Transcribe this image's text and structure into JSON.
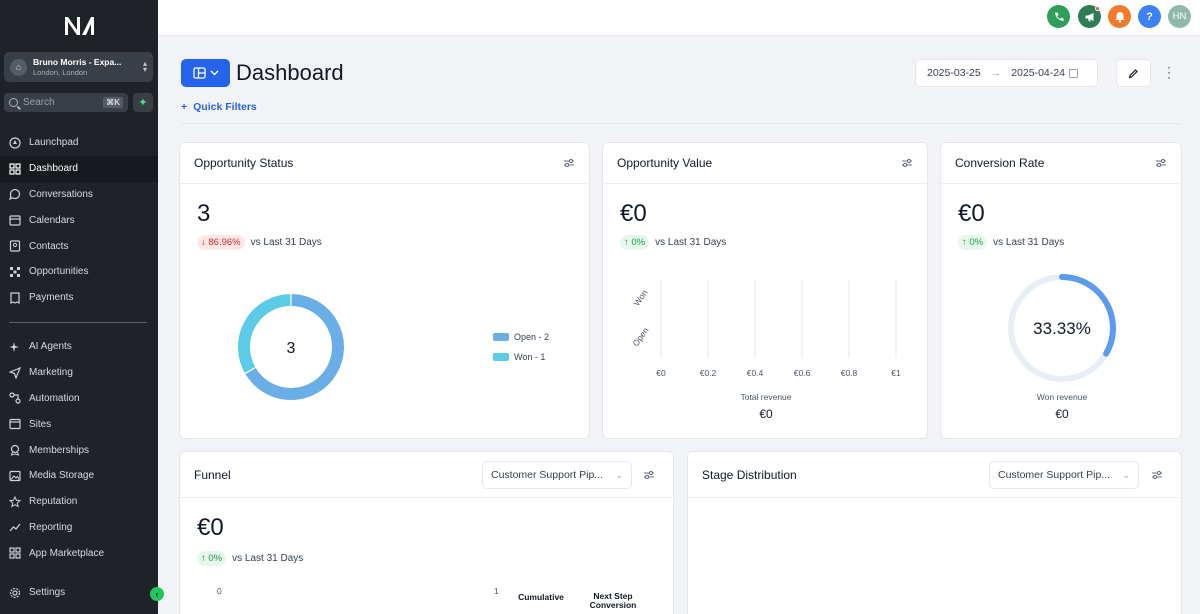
{
  "sidebar": {
    "account_name": "Bruno Morris - Expa...",
    "account_location": "London, London",
    "search_placeholder": "Search",
    "search_shortcut": "⌘K",
    "items": [
      {
        "label": "Launchpad"
      },
      {
        "label": "Dashboard"
      },
      {
        "label": "Conversations"
      },
      {
        "label": "Calendars"
      },
      {
        "label": "Contacts"
      },
      {
        "label": "Opportunities"
      },
      {
        "label": "Payments"
      },
      {
        "label": "AI Agents"
      },
      {
        "label": "Marketing"
      },
      {
        "label": "Automation"
      },
      {
        "label": "Sites"
      },
      {
        "label": "Memberships"
      },
      {
        "label": "Media Storage"
      },
      {
        "label": "Reputation"
      },
      {
        "label": "Reporting"
      },
      {
        "label": "App Marketplace"
      },
      {
        "label": "Settings"
      }
    ]
  },
  "topbar": {
    "avatar_initials": "HN",
    "help_label": "?",
    "colors": {
      "phone": "#2f9e58",
      "megaphone": "#2f7d52",
      "bell": "#f47a2b",
      "help": "#3b82f6",
      "avatar": "#8fb9ad"
    }
  },
  "header": {
    "title": "Dashboard",
    "quick_filters": "Quick Filters",
    "date_start": "2025-03-25",
    "date_end": "2025-04-24"
  },
  "cards": {
    "opportunity_status": {
      "title": "Opportunity Status",
      "value": "3",
      "change": "86.96%",
      "vs_text": "vs Last 31 Days",
      "donut_center": "3",
      "legend": [
        {
          "label": "Open - 2",
          "color": "#6aaee8"
        },
        {
          "label": "Won - 1",
          "color": "#5ccbe8"
        }
      ]
    },
    "opportunity_value": {
      "title": "Opportunity Value",
      "value": "€0",
      "change": "0%",
      "vs_text": "vs Last 31 Days",
      "y_labels": [
        "Won",
        "Open"
      ],
      "x_ticks": [
        "€0",
        "€0.2",
        "€0.4",
        "€0.6",
        "€0.8",
        "€1"
      ],
      "footer_label": "Total revenue",
      "footer_value": "€0"
    },
    "conversion_rate": {
      "title": "Conversion Rate",
      "value": "€0",
      "change": "0%",
      "vs_text": "vs Last 31 Days",
      "gauge_text": "33.33%",
      "gauge_fraction": 0.3333,
      "footer_label": "Won revenue",
      "footer_value": "€0"
    },
    "funnel": {
      "title": "Funnel",
      "pipeline": "Customer Support Pip...",
      "value": "€0",
      "change": "0%",
      "vs_text": "vs Last 31 Days",
      "axis_start": "0",
      "axis_end": "1",
      "col1": "Cumulative",
      "col2": "Next Step Conversion"
    },
    "stage_distribution": {
      "title": "Stage Distribution",
      "pipeline": "Customer Support Pip..."
    }
  },
  "chart_data": [
    {
      "type": "pie",
      "categories": [
        "Open",
        "Won"
      ],
      "values": [
        2,
        1
      ],
      "center_label": "3"
    },
    {
      "type": "bar",
      "categories": [
        "Won",
        "Open"
      ],
      "values": [
        0,
        0
      ],
      "xlim": [
        0,
        1
      ],
      "xlabel": "Total revenue"
    }
  ]
}
